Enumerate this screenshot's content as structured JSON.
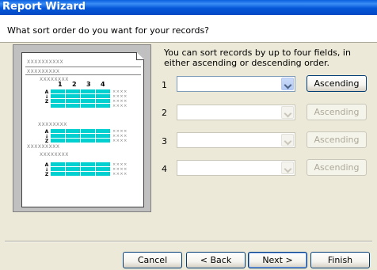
{
  "window": {
    "title": "Report Wizard"
  },
  "header": {
    "question": "What sort order do you want for your records?"
  },
  "instructions": "You can sort records by up to four fields, in either ascending or descending order.",
  "sort_rows": [
    {
      "number": "1",
      "field_value": "",
      "order_label": "Ascending",
      "enabled": true
    },
    {
      "number": "2",
      "field_value": "",
      "order_label": "Ascending",
      "enabled": false
    },
    {
      "number": "3",
      "field_value": "",
      "order_label": "Ascending",
      "enabled": false
    },
    {
      "number": "4",
      "field_value": "",
      "order_label": "Ascending",
      "enabled": false
    }
  ],
  "preview": {
    "placeholder_long": "XXXXXXXXXX",
    "placeholder_mid": "XXXXXXXXX",
    "placeholder_short": "XXXXXXXX",
    "column_numbers": [
      "1",
      "2",
      "3",
      "4"
    ],
    "sort_letters": [
      "A",
      "Z"
    ]
  },
  "buttons": {
    "cancel": "Cancel",
    "back": "< Back",
    "next": "Next >",
    "finish": "Finish"
  },
  "colors": {
    "title_bar": "#0a5fde",
    "preview_cells": "#00d0d0",
    "dialog_bg": "#ece9d8"
  }
}
